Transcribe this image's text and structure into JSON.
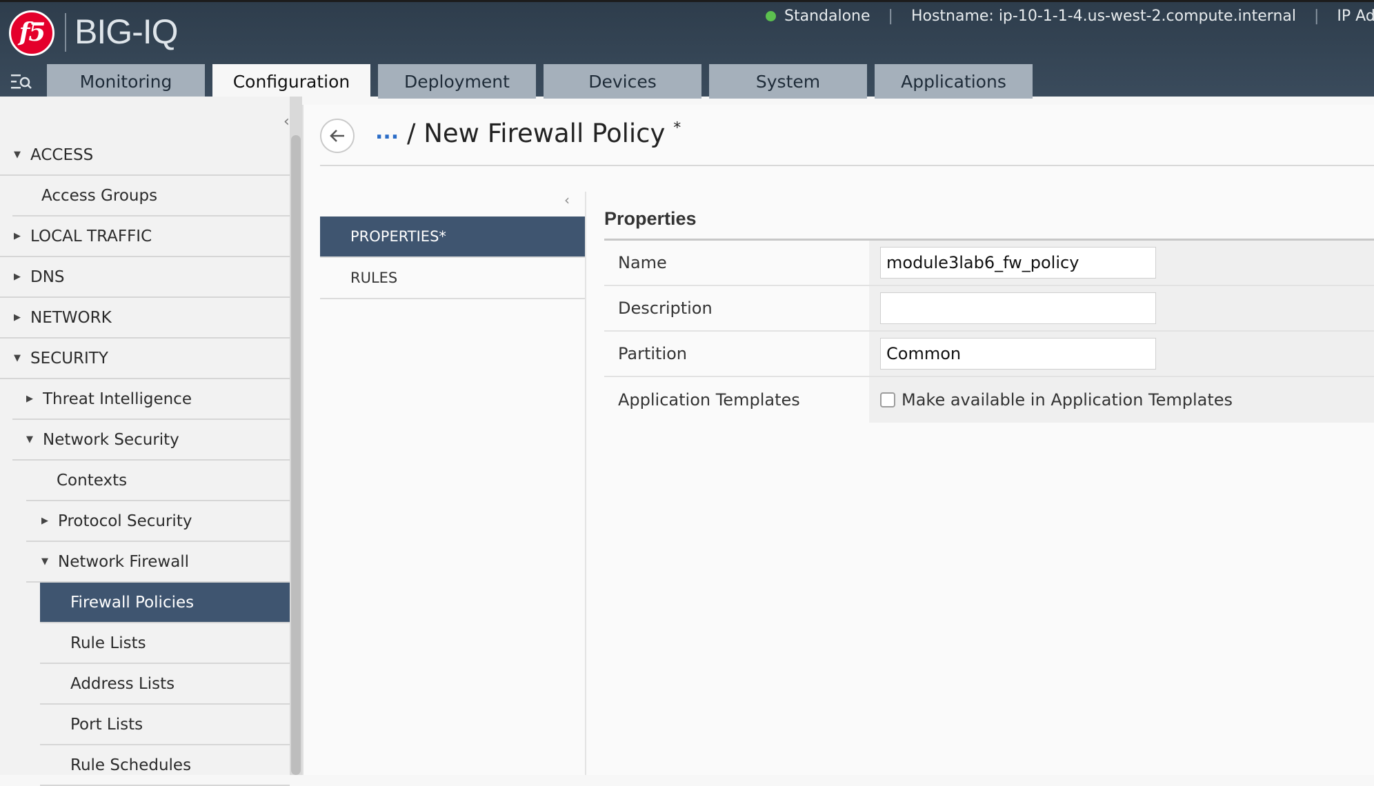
{
  "header": {
    "logo_text": "f5",
    "product": "BIG-IQ",
    "status": "Standalone",
    "hostname": "Hostname: ip-10-1-1-4.us-west-2.compute.internal",
    "ip": "IP Addres",
    "status_color": "#5cc04f"
  },
  "tabs": [
    "Monitoring",
    "Configuration",
    "Deployment",
    "Devices",
    "System",
    "Applications"
  ],
  "sidebar": {
    "items": [
      {
        "label": "ACCESS"
      },
      {
        "label": "Access Groups"
      },
      {
        "label": "LOCAL TRAFFIC"
      },
      {
        "label": "DNS"
      },
      {
        "label": "NETWORK"
      },
      {
        "label": "SECURITY"
      },
      {
        "label": "Threat Intelligence"
      },
      {
        "label": "Network Security"
      },
      {
        "label": "Contexts"
      },
      {
        "label": "Protocol Security"
      },
      {
        "label": "Network Firewall"
      },
      {
        "label": "Firewall Policies"
      },
      {
        "label": "Rule Lists"
      },
      {
        "label": "Address Lists"
      },
      {
        "label": "Port Lists"
      },
      {
        "label": "Rule Schedules"
      }
    ]
  },
  "main": {
    "breadcrumb_more": "...",
    "title": "/ New Firewall Policy",
    "title_mark": "*",
    "side_menu": [
      "PROPERTIES*",
      "RULES"
    ],
    "section_title": "Properties",
    "form": {
      "name_label": "Name",
      "name_value": "module3lab6_fw_policy",
      "description_label": "Description",
      "description_value": "",
      "partition_label": "Partition",
      "partition_value": "Common",
      "app_templates_label": "Application Templates",
      "app_templates_checkbox": "Make available in Application Templates"
    }
  },
  "colors": {
    "header_bg": "#2e3d4c",
    "selected_bg": "#3f5570",
    "tab_inactive": "#a5b0bb",
    "link_blue": "#2a6cc7"
  }
}
